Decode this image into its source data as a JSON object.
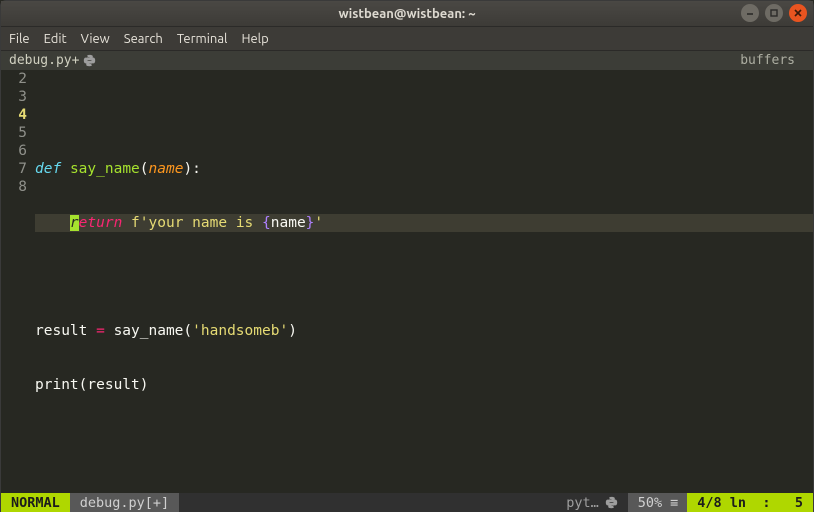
{
  "window": {
    "title": "wistbean@wistbean: ~"
  },
  "menu": {
    "file": "File",
    "edit": "Edit",
    "view": "View",
    "search": "Search",
    "terminal": "Terminal",
    "help": "Help"
  },
  "bufferline": {
    "tab": "debug.py+",
    "right": "buffers"
  },
  "gutter": {
    "l2": "2",
    "l3": "3",
    "l4": "4",
    "l5": "5",
    "l6": "6",
    "l7": "7",
    "l8": "8"
  },
  "code": {
    "l3": {
      "def": "def",
      "sp1": " ",
      "fn": "say_name",
      "open": "(",
      "param": "name",
      "close": "):"
    },
    "l4": {
      "indent": "    ",
      "cursor": "r",
      "eturn": "eturn",
      "sp": " ",
      "f": "f",
      "q1": "'",
      "s1": "your name is ",
      "lb": "{",
      "var": "name",
      "rb": "}",
      "q2": "'"
    },
    "l6": {
      "a": "result ",
      "eq": "=",
      "b": " say_name(",
      "q1": "'",
      "s": "handsomeb",
      "q2": "'",
      "c": ")"
    },
    "l7": {
      "a": "print(result)"
    }
  },
  "status": {
    "mode": "NORMAL",
    "file": "debug.py[+]",
    "filetype": "pyt…",
    "percent": "50%",
    "hamburger": "≡",
    "pos": "4/8 ln",
    "colon": ":",
    "col": "5"
  }
}
